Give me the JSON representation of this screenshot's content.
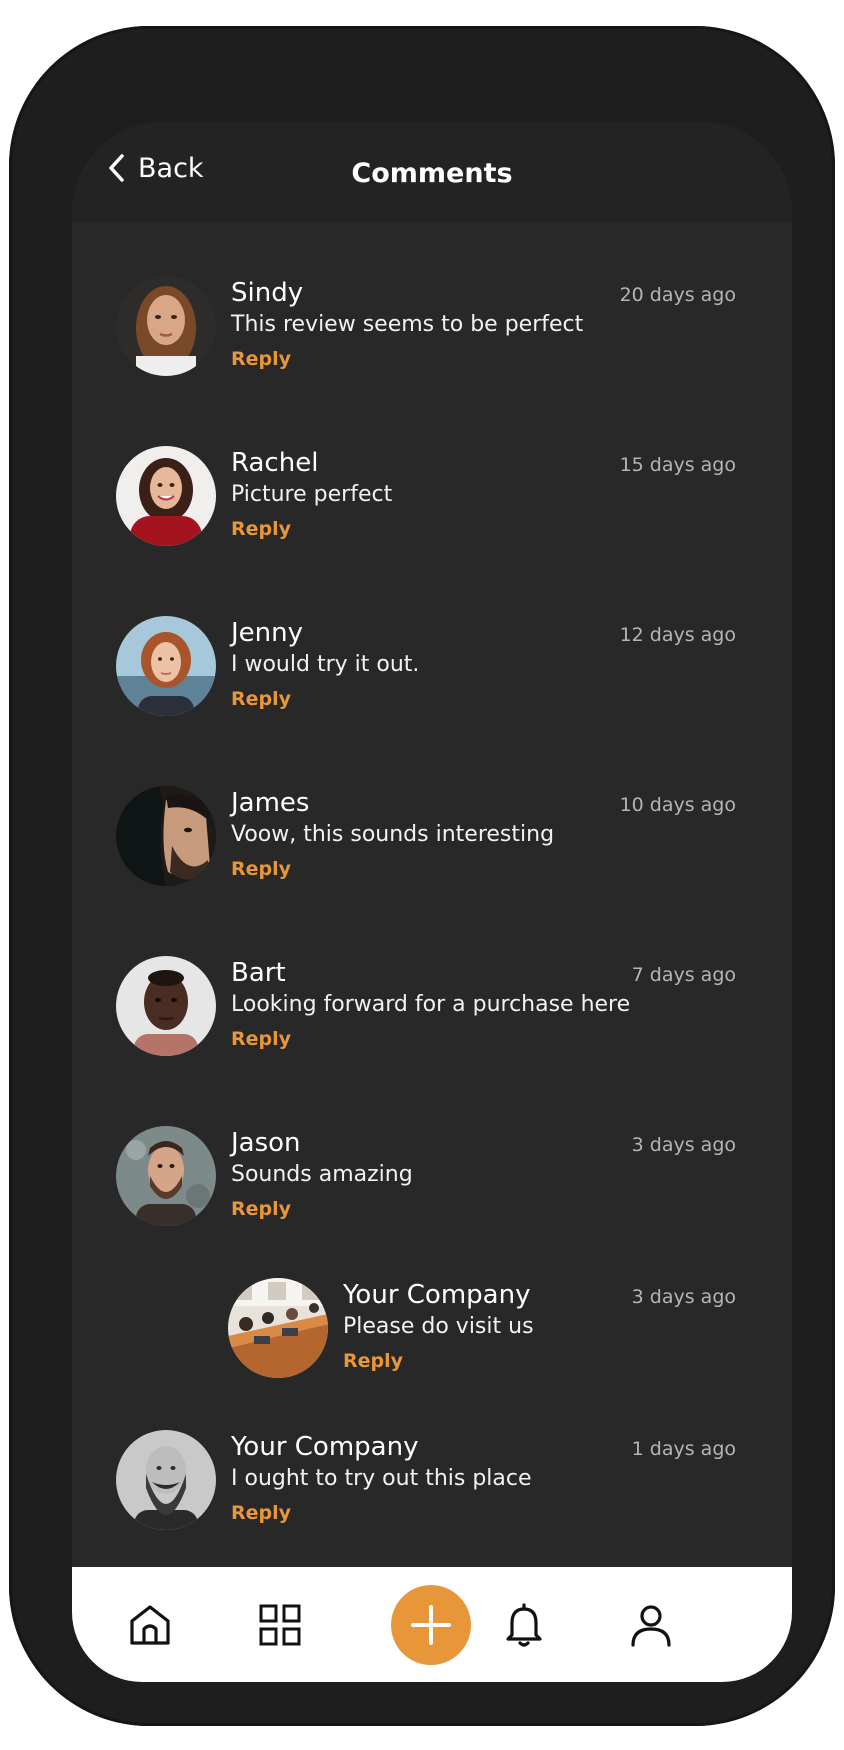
{
  "header": {
    "back_label": "Back",
    "title": "Comments"
  },
  "comments": [
    {
      "name": "Sindy",
      "text": "This review seems to be perfect",
      "time": "20 days ago",
      "reply": "Reply",
      "avatar": "avatar-sindy"
    },
    {
      "name": "Rachel",
      "text": "Picture perfect",
      "time": "15 days ago",
      "reply": "Reply",
      "avatar": "avatar-rachel"
    },
    {
      "name": "Jenny",
      "text": "I would try it out.",
      "time": "12 days ago",
      "reply": "Reply",
      "avatar": "avatar-jenny"
    },
    {
      "name": "James",
      "text": "Voow, this sounds interesting",
      "time": "10 days ago",
      "reply": "Reply",
      "avatar": "avatar-james"
    },
    {
      "name": "Bart",
      "text": "Looking forward for a purchase here",
      "time": "7 days ago",
      "reply": "Reply",
      "avatar": "avatar-bart"
    },
    {
      "name": "Jason",
      "text": "Sounds amazing",
      "time": "3 days ago",
      "reply": "Reply",
      "avatar": "avatar-jason"
    },
    {
      "name": "Your Company",
      "text": "Please do visit us",
      "time": "3 days ago",
      "reply": "Reply",
      "avatar": "avatar-company"
    },
    {
      "name": "Your Company",
      "text": "I ought to try out this place",
      "time": "1 days ago",
      "reply": "Reply",
      "avatar": "avatar-bearded"
    }
  ],
  "tabbar": {
    "icons": [
      "home-icon",
      "grid-icon",
      "plus-icon",
      "bell-icon",
      "user-icon"
    ]
  },
  "colors": {
    "accent": "#e8963a",
    "screen_bg": "#282828",
    "header_bg": "#232323",
    "tabbar_bg": "#ffffff"
  }
}
